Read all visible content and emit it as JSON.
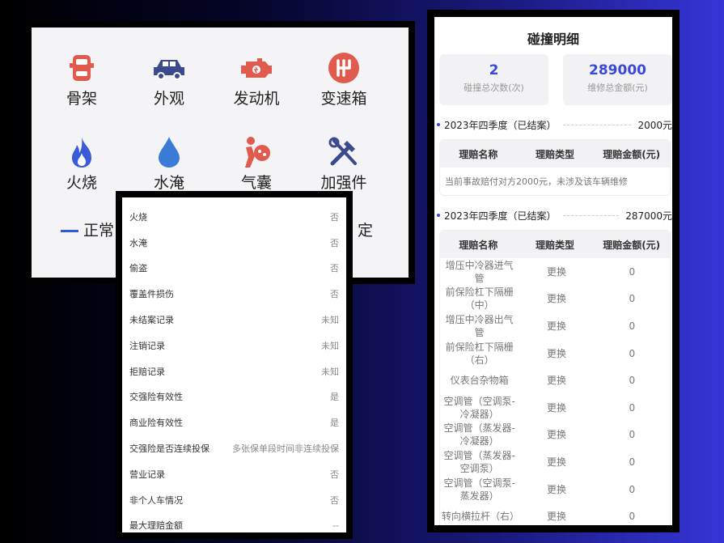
{
  "categories": [
    {
      "label": "骨架",
      "icon": "car-frame-icon",
      "color": "#e05a4e"
    },
    {
      "label": "外观",
      "icon": "car-exterior-icon",
      "color": "#3a4a8c"
    },
    {
      "label": "发动机",
      "icon": "engine-icon",
      "color": "#e05a4e"
    },
    {
      "label": "变速箱",
      "icon": "gearbox-icon",
      "color": "#e05a4e"
    },
    {
      "label": "火烧",
      "icon": "fire-icon",
      "color": "#3a5bd8"
    },
    {
      "label": "水淹",
      "icon": "water-drop-icon",
      "color": "#3a7bd8"
    },
    {
      "label": "气囊",
      "icon": "airbag-icon",
      "color": "#e05a4e"
    },
    {
      "label": "加强件",
      "icon": "tools-icon",
      "color": "#3a4a8c"
    }
  ],
  "legend": {
    "normal": "正常",
    "right_fragment": "定"
  },
  "records": [
    {
      "label": "火烧",
      "value": "否"
    },
    {
      "label": "水淹",
      "value": "否"
    },
    {
      "label": "偷盗",
      "value": "否"
    },
    {
      "label": "覆盖件损伤",
      "value": "否"
    },
    {
      "label": "未结案记录",
      "value": "未知"
    },
    {
      "label": "注销记录",
      "value": "未知"
    },
    {
      "label": "拒赔记录",
      "value": "未知"
    },
    {
      "label": "交强险有效性",
      "value": "是"
    },
    {
      "label": "商业险有效性",
      "value": "是"
    },
    {
      "label": "交强险是否连续投保",
      "value": "多张保单段时间非连续投保"
    },
    {
      "label": "营业记录",
      "value": "否"
    },
    {
      "label": "非个人车情况",
      "value": "否"
    },
    {
      "label": "最大理赔金额",
      "value": "--"
    }
  ],
  "detail": {
    "title": "碰撞明细",
    "stats": [
      {
        "value": "2",
        "caption": "碰撞总次数(次)"
      },
      {
        "value": "289000",
        "caption": "维修总金额(元)"
      }
    ],
    "columns": [
      "理赔名称",
      "理赔类型",
      "理赔金额(元)"
    ],
    "periods": [
      {
        "label": "2023年四季度（已结案）",
        "amount": "2000元",
        "note": "当前事故赔付对方2000元，未涉及该车辆维修"
      },
      {
        "label": "2023年四季度（已结案）",
        "amount": "287000元",
        "items": [
          {
            "name": "增压中冷器进气管",
            "type": "更换",
            "amount": "0"
          },
          {
            "name": "前保险杠下隔栅（中）",
            "type": "更换",
            "amount": "0"
          },
          {
            "name": "增压中冷器出气管",
            "type": "更换",
            "amount": "0"
          },
          {
            "name": "前保险杠下隔栅（右）",
            "type": "更换",
            "amount": "0"
          },
          {
            "name": "仪表台杂物箱",
            "type": "更换",
            "amount": "0"
          },
          {
            "name": "空调管（空调泵-冷凝器）",
            "type": "更换",
            "amount": "0"
          },
          {
            "name": "空调管（蒸发器-冷凝器）",
            "type": "更换",
            "amount": "0"
          },
          {
            "name": "空调管（蒸发器-空调泵）",
            "type": "更换",
            "amount": "0"
          },
          {
            "name": "空调管（空调泵-蒸发器）",
            "type": "更换",
            "amount": "0"
          },
          {
            "name": "转向横拉杆（右）",
            "type": "更换",
            "amount": "0"
          }
        ]
      }
    ]
  }
}
